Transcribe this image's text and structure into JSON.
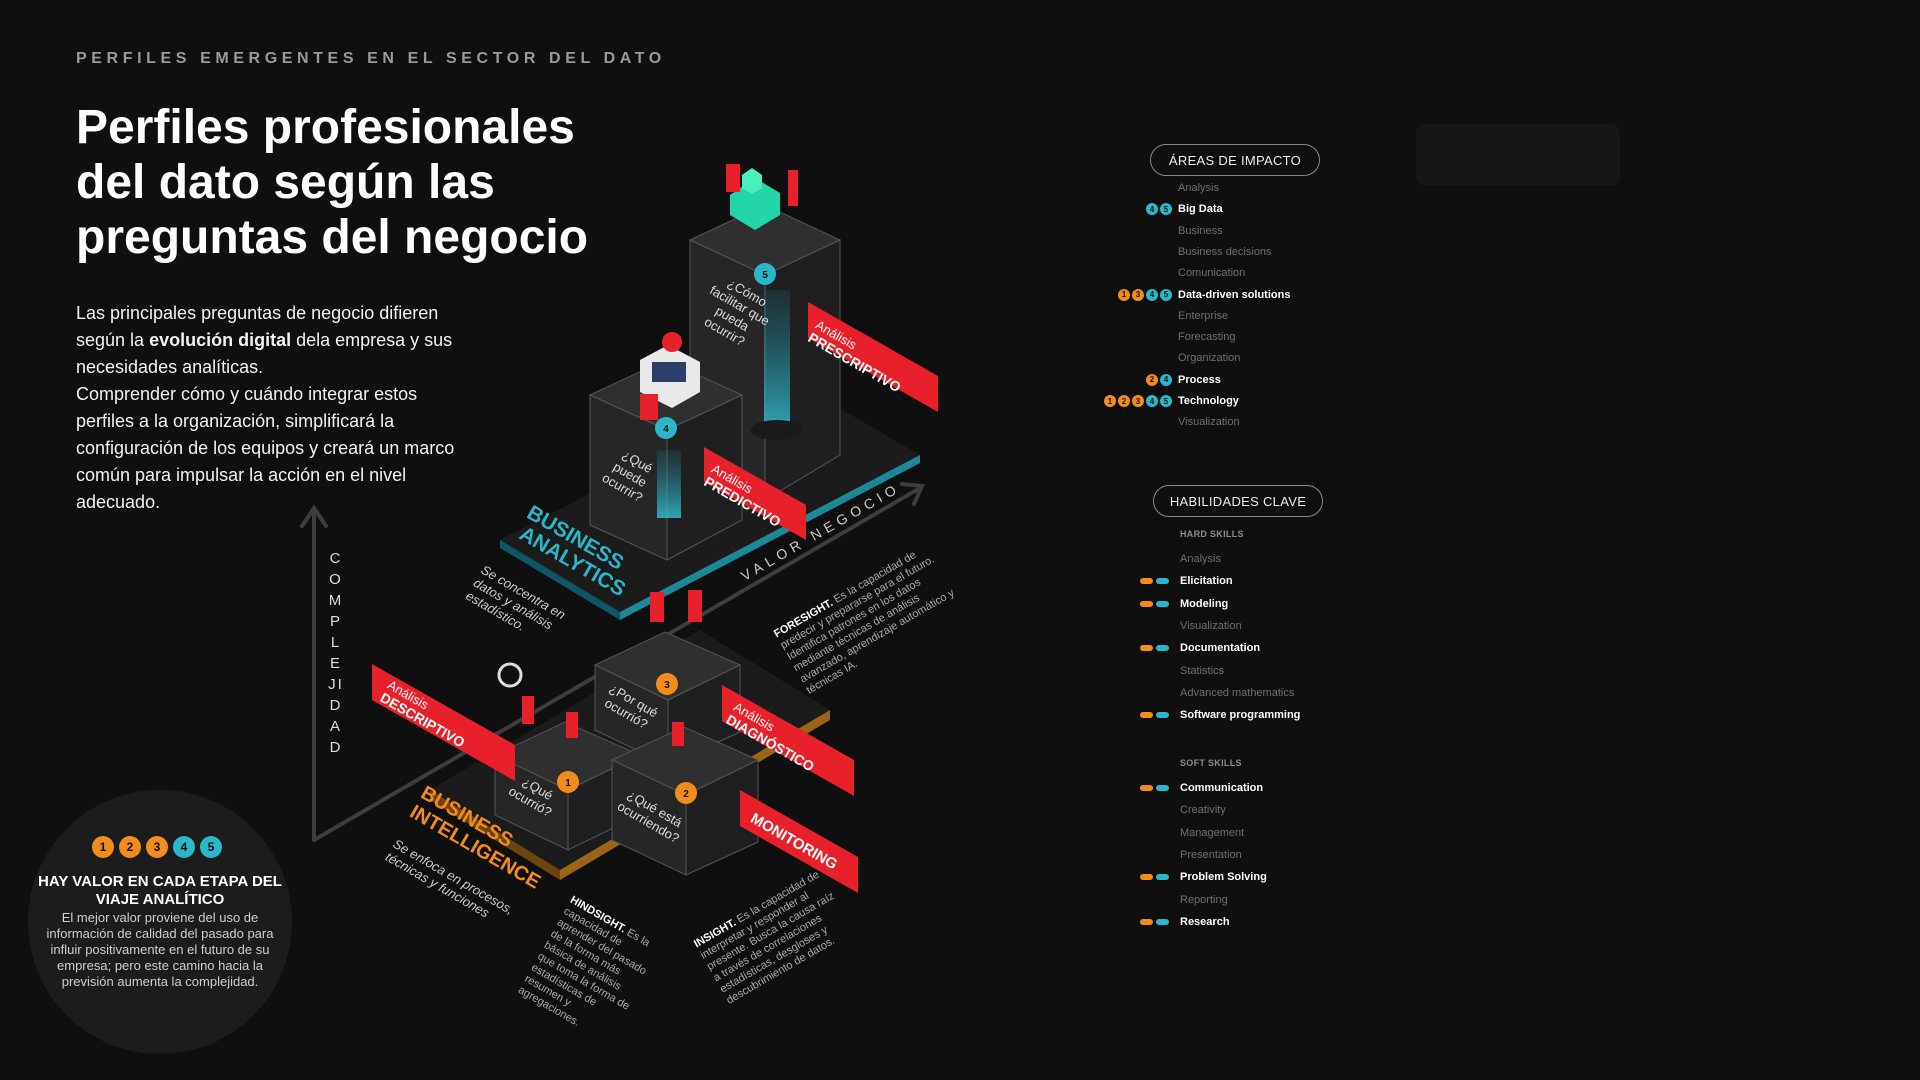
{
  "header": {
    "kicker": "PERFILES EMERGENTES EN EL SECTOR DEL DATO",
    "title": "Perfiles profesionales del dato según las preguntas del negocio"
  },
  "intro": {
    "p1_before": "Las principales preguntas de negocio difieren según la ",
    "p1_bold": "evolución digital",
    "p1_after": " dela empresa y sus necesidades analíticas.",
    "p2": "Comprender cómo y cuándo integrar estos perfiles a la organización, simplificará la configuración de los equipos y creará un marco común para impulsar la acción en el nivel adecuado."
  },
  "diagram": {
    "axis_y": "COMPLEJIDAD",
    "axis_x": "VALOR NEGOCIO",
    "blocks": [
      {
        "num": "1",
        "question": "¿Qué ocurrió?",
        "label_top": "Análisis",
        "label_bottom": "DESCRIPTIVO"
      },
      {
        "num": "2",
        "question": "¿Qué está ocurriendo?",
        "label_top": "",
        "label_bottom": "MONITORING"
      },
      {
        "num": "3",
        "question": "¿Por qué ocurrió?",
        "label_top": "Análisis",
        "label_bottom": "DIAGNÓSTICO"
      },
      {
        "num": "4",
        "question": "¿Qué puede ocurrir?",
        "label_top": "Análisis",
        "label_bottom": "PREDICTIVO"
      },
      {
        "num": "5",
        "question": "¿Cómo facilitar que pueda ocurrir?",
        "label_top": "Análisis",
        "label_bottom": "PRESCRIPTIVO"
      }
    ],
    "platforms": {
      "bi_l1": "BUSINESS",
      "bi_l2": "INTELLIGENCE",
      "bi_desc": "Se enfoca en procesos, técnicas y funciones",
      "ba_l1": "BUSINESS",
      "ba_l2": "ANALYTICS",
      "ba_desc": "Se concentra en datos y análisis estadístico."
    },
    "notes": {
      "hindsight_title": "HINDSIGHT.",
      "hindsight_text": "Es la capacidad de aprender del pasado de la forma más básica de análisis que toma la forma de estadísticas de resumen y agregaciones.",
      "insight_title": "INSIGHT.",
      "insight_text": "Es la capacidad de interpretar y responder al presente. Busca la causa raíz a través de correlaciones estadísticas, desgloses y descubrimiento de datos.",
      "foresight_title": "FORESIGHT.",
      "foresight_text": "Es la capacidad de predecir y prepararse para el futuro. Identifica patrones en los datos mediante técnicas de análisis avanzado, aprendizaje automático y técnicas IA."
    }
  },
  "areas": {
    "title": "ÁREAS DE IMPACTO",
    "items": [
      {
        "label": "Analysis",
        "hi": false,
        "dots": []
      },
      {
        "label": "Big Data",
        "hi": true,
        "dots": [
          "4",
          "5"
        ]
      },
      {
        "label": "Business",
        "hi": false,
        "dots": []
      },
      {
        "label": "Business decisions",
        "hi": false,
        "dots": []
      },
      {
        "label": "Comunication",
        "hi": false,
        "dots": []
      },
      {
        "label": "Data-driven solutions",
        "hi": true,
        "dots": [
          "1",
          "3",
          "4",
          "5"
        ]
      },
      {
        "label": "Enterprise",
        "hi": false,
        "dots": []
      },
      {
        "label": "Forecasting",
        "hi": false,
        "dots": []
      },
      {
        "label": "Organization",
        "hi": false,
        "dots": []
      },
      {
        "label": "Process",
        "hi": true,
        "dots": [
          "2",
          "4"
        ]
      },
      {
        "label": "Technology",
        "hi": true,
        "dots": [
          "1",
          "2",
          "3",
          "4",
          "5"
        ]
      },
      {
        "label": "Visualization",
        "hi": false,
        "dots": []
      }
    ]
  },
  "skills": {
    "title": "HABILIDADES CLAVE",
    "hard_title": "HARD SKILLS",
    "hard": [
      {
        "label": "Analysis",
        "hi": false
      },
      {
        "label": "Elicitation",
        "hi": true
      },
      {
        "label": "Modeling",
        "hi": true
      },
      {
        "label": "Visualization",
        "hi": false
      },
      {
        "label": "Documentation",
        "hi": true
      },
      {
        "label": "Statistics",
        "hi": false
      },
      {
        "label": "Advanced mathematics",
        "hi": false
      },
      {
        "label": "Software programming",
        "hi": true
      }
    ],
    "soft_title": "SOFT SKILLS",
    "soft": [
      {
        "label": "Communication",
        "hi": true
      },
      {
        "label": "Creativity",
        "hi": false
      },
      {
        "label": "Management",
        "hi": false
      },
      {
        "label": "Presentation",
        "hi": false
      },
      {
        "label": "Problem Solving",
        "hi": true
      },
      {
        "label": "Reporting",
        "hi": false
      },
      {
        "label": "Research",
        "hi": true
      }
    ]
  },
  "value_circle": {
    "numbers": [
      "1",
      "2",
      "3",
      "4",
      "5"
    ],
    "title": "HAY VALOR EN CADA ETAPA DEL VIAJE ANALÍTICO",
    "text": "El mejor valor proviene del uso de información de calidad del pasado para influir positivamente en el futuro de su empresa; pero este camino hacia la previsión aumenta la complejidad."
  },
  "colors": {
    "background": "#0f0f0f",
    "accent_red": "#e8202a",
    "accent_orange": "#f28c1b",
    "accent_turquoise": "#2ab7c9",
    "block_fill": "#262626"
  }
}
